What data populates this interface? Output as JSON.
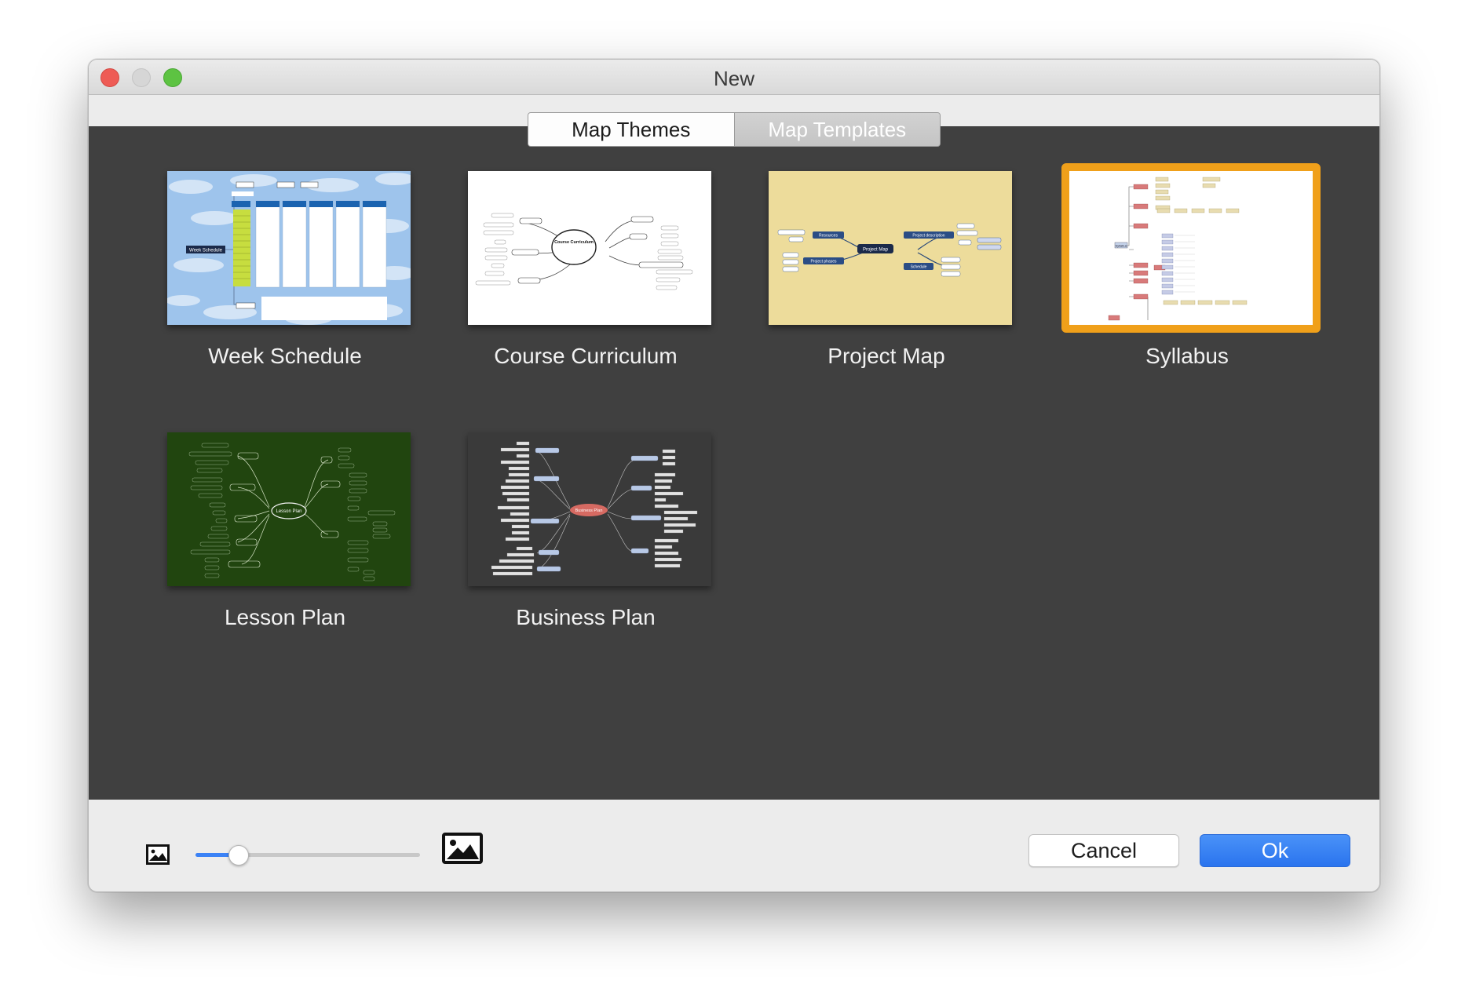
{
  "window": {
    "title": "New"
  },
  "tabs": [
    {
      "label": "Map Themes",
      "selected": true
    },
    {
      "label": "Map Templates",
      "selected": false
    }
  ],
  "templates": [
    {
      "label": "Week Schedule",
      "selected": false,
      "thumb": "week-schedule-thumbnail"
    },
    {
      "label": "Course Curriculum",
      "selected": false,
      "thumb": "course-curriculum-thumbnail"
    },
    {
      "label": "Project Map",
      "selected": false,
      "thumb": "project-map-thumbnail"
    },
    {
      "label": "Syllabus",
      "selected": true,
      "thumb": "syllabus-thumbnail"
    },
    {
      "label": "Lesson Plan",
      "selected": false,
      "thumb": "lesson-plan-thumbnail"
    },
    {
      "label": "Business Plan",
      "selected": false,
      "thumb": "business-plan-thumbnail"
    }
  ],
  "thumbnail_text": {
    "week": "Week Schedule",
    "course": "Course Curriculum",
    "project": "Project Map",
    "project_resources": "Resources",
    "project_description": "Project description",
    "project_phases": "Project phases",
    "project_schedule": "Schedule",
    "syllabus": "Syllabus",
    "lesson": "Lesson Plan",
    "business": "Business Plan"
  },
  "zoom": {
    "small_icon": "small-image-icon",
    "large_icon": "large-image-icon",
    "value": 0.19
  },
  "buttons": {
    "cancel": "Cancel",
    "ok": "Ok"
  },
  "colors": {
    "accent_blue": "#2a74ee",
    "selection_orange": "#f0a01a",
    "content_bg": "#404040"
  }
}
